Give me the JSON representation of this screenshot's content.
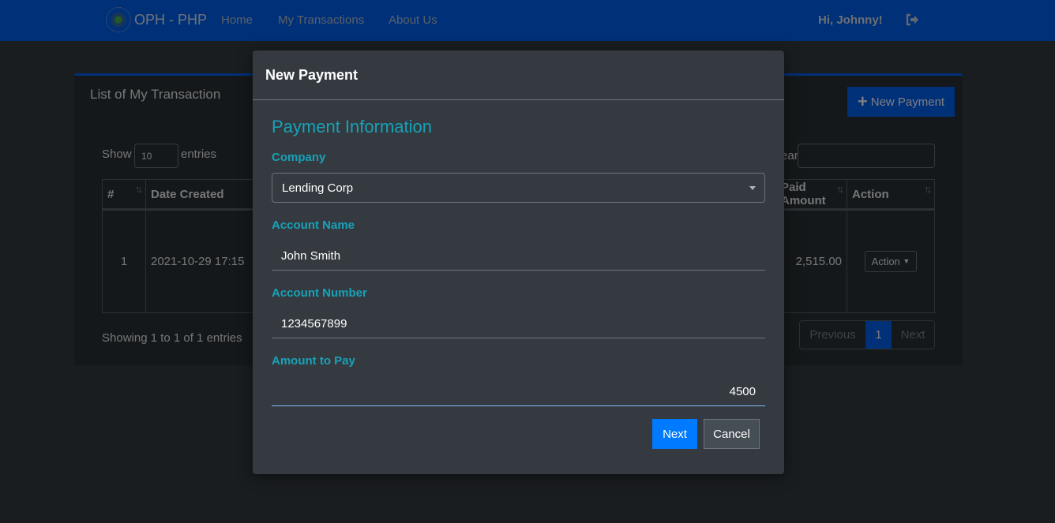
{
  "navbar": {
    "brand": "OPH - PHP",
    "links": [
      "Home",
      "My Transactions",
      "About Us"
    ],
    "greeting": "Hi, Johnny!",
    "logout_icon": "sign-out-icon",
    "color": "#0060f0"
  },
  "card": {
    "title": "List of My Transaction",
    "new_payment_label": "New Payment",
    "show_label": "Show",
    "page_length": "10",
    "entries_label": "entries",
    "search_label": "Search:",
    "search_value": "",
    "columns": [
      "#",
      "Date Created",
      "Paid Amount",
      "Action"
    ],
    "rows": [
      {
        "num": "1",
        "date_created": "2021-10-29 17:15",
        "amount": "2,515.00",
        "action": "Action"
      }
    ],
    "info": "Showing 1 to 1 of 1 entries",
    "pagination": {
      "previous": "Previous",
      "current": "1",
      "next": "Next"
    }
  },
  "modal": {
    "title": "New Payment",
    "section_title": "Payment Information",
    "fields": {
      "company": {
        "label": "Company",
        "value": "Lending Corp"
      },
      "account_name": {
        "label": "Account Name",
        "value": "John Smith"
      },
      "account_number": {
        "label": "Account Number",
        "value": "1234567899"
      },
      "amount": {
        "label": "Amount to Pay",
        "value": "4500"
      }
    },
    "next_label": "Next",
    "cancel_label": "Cancel",
    "accent": "#17a2b8",
    "primary": "#007bff"
  }
}
